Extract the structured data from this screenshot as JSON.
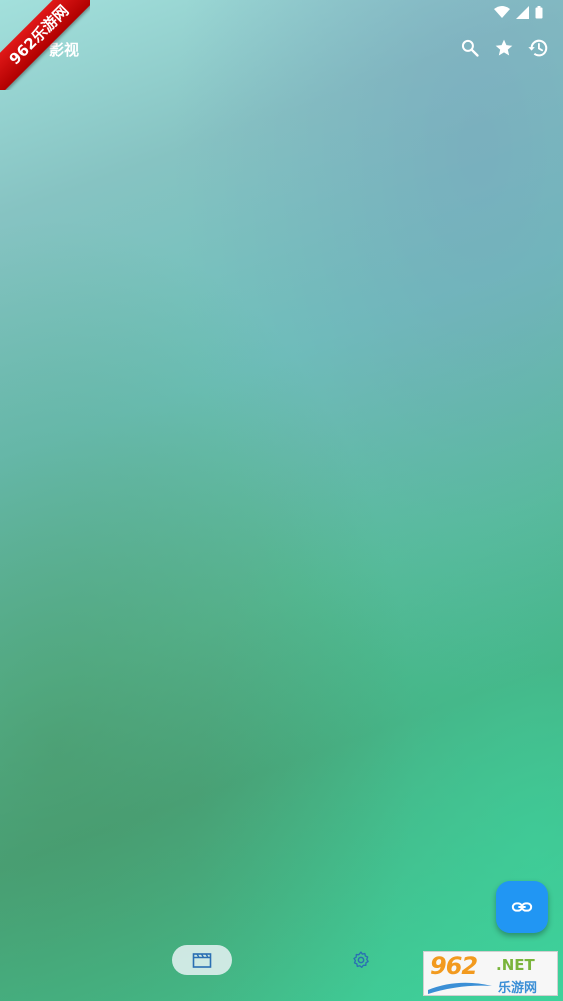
{
  "app_bar": {
    "title": "影视",
    "actions": [
      {
        "icon": "search-icon"
      },
      {
        "icon": "star-icon"
      },
      {
        "icon": "history-icon"
      }
    ]
  },
  "status_bar": {
    "icons": [
      "wifi-icon",
      "signal-icon",
      "battery-icon"
    ]
  },
  "watermark": {
    "ribbon_text": "962乐游网"
  },
  "fab": {
    "icon": "link-icon"
  },
  "bottom_nav": {
    "items": [
      {
        "icon": "movie-clapper-icon",
        "selected": true
      },
      {
        "icon": "settings-gear-icon",
        "selected": false
      }
    ]
  },
  "site_logo": {
    "number": "962",
    "domain": ".NET",
    "chinese": "乐游网"
  },
  "colors": {
    "fab": "#2196f3",
    "nav_icon": "#2a6fb3",
    "ribbon": "#cc0000"
  }
}
